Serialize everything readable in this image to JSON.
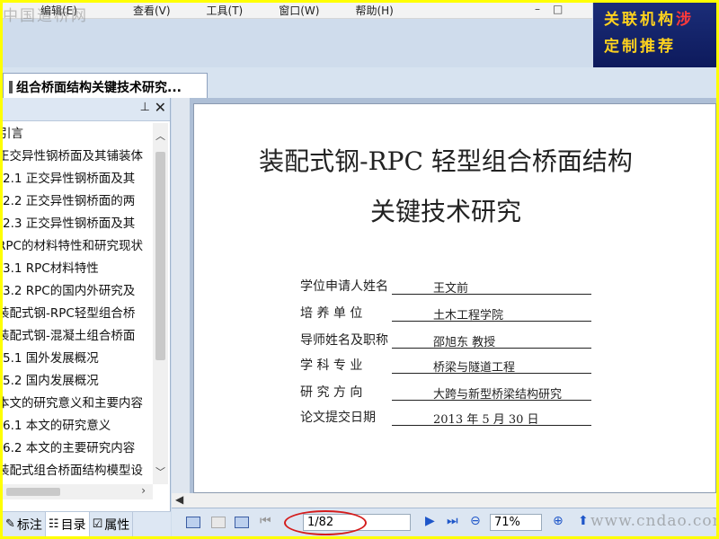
{
  "watermark_top": "中国道桥网",
  "menu": [
    "编辑(E)",
    "查看(V)",
    "工具(T)",
    "窗口(W)",
    "帮助(H)"
  ],
  "banner": {
    "line1": "关联机构",
    "line1_red": "涉",
    "line2": "定制推荐"
  },
  "tab": {
    "title": "组合桥面结构关键技术研究..."
  },
  "toc": [
    "引言",
    "正交异性钢桥面及其铺装体",
    "2.1 正交异性钢桥面及其",
    "2.2 正交异性钢桥面的两",
    "2.3 正交异性钢桥面及其",
    "RPC的材料特性和研究现状",
    "3.1 RPC材料特性",
    "3.2 RPC的国内外研究及",
    "装配式钢-RPC轻型组合桥",
    "装配式钢-混凝土组合桥面",
    "5.1 国外发展概况",
    "5.2 国内发展概况",
    "本文的研究意义和主要内容",
    "6.1 本文的研究意义",
    "6.2 本文的主要研究内容",
    "装配式组合桥面结构模型设"
  ],
  "pane_tabs": [
    {
      "icon": "✎",
      "label": "标注"
    },
    {
      "icon": "☷",
      "label": "目录"
    },
    {
      "icon": "☑",
      "label": "属性"
    }
  ],
  "doc": {
    "title_line1": "装配式钢-RPC 轻型组合桥面结构",
    "title_line2": "关键技术研究",
    "fields": [
      {
        "label": "学位申请人姓名",
        "value": "王文前"
      },
      {
        "label": "培  养  单  位",
        "value": "土木工程学院"
      },
      {
        "label": "导师姓名及职称",
        "value": "邵旭东  教授"
      },
      {
        "label": "学  科  专  业",
        "value": "桥梁与隧道工程"
      },
      {
        "label": "研  究  方  向",
        "value": "大跨与新型桥梁结构研究"
      },
      {
        "label": "论文提交日期",
        "value": "2013 年 5 月 30 日"
      }
    ]
  },
  "status": {
    "page": "1/82",
    "zoom": "71%",
    "watermark": "www.cndao.com"
  }
}
